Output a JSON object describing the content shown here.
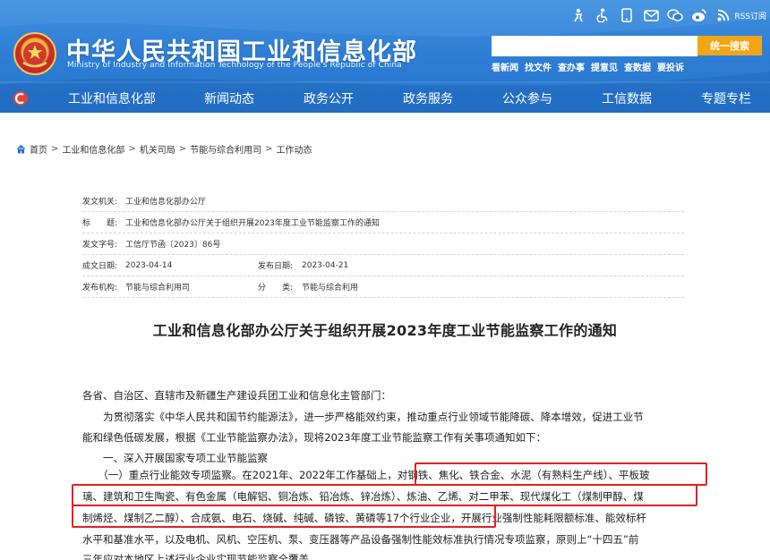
{
  "header": {
    "site_title": "中华人民共和国工业和信息化部",
    "site_subtitle": "Ministry of Industry and Information Technology of the People's Republic of China",
    "search": {
      "placeholder": "",
      "button_label": "统一搜索"
    },
    "quick_links": [
      "看新闻",
      "找文件",
      "查办事",
      "提意见",
      "查数据",
      "要投诉"
    ],
    "rss_label": "RSS订阅",
    "top_icons": [
      "elderly-mode-icon",
      "accessibility-icon",
      "mobile-icon",
      "mail-icon",
      "wechat-icon",
      "weibo-icon",
      "rss-icon"
    ]
  },
  "nav": {
    "items": [
      "工业和信息化部",
      "新闻动态",
      "政务公开",
      "政务服务",
      "公众参与",
      "工信数据",
      "专题专栏"
    ]
  },
  "breadcrumb": [
    "首页",
    "工业和信息化部",
    "机关司局",
    "节能与综合利用司",
    "工作动态"
  ],
  "meta": {
    "issuer_label": "发文机关:",
    "issuer": "工业和信息化部办公厅",
    "title_label": "标　　题:",
    "title": "工业和信息化部办公厅关于组织开展2023年度工业节能监察工作的通知",
    "doc_no_label": "发文字号:",
    "doc_no": "工信厅节函〔2023〕86号",
    "written_label": "成文日期:",
    "written": "2023-04-14",
    "published_label": "发布日期:",
    "published": "2023-04-21",
    "publisher_label": "发布机构:",
    "publisher": "节能与综合利用司",
    "category_label": "分　　类:",
    "category": "节能与综合利用"
  },
  "article": {
    "title": "工业和信息化部办公厅关于组织开展2023年度工业节能监察工作的通知",
    "lines": [
      "各省、自治区、直辖市及新疆生产建设兵团工业和信息化主管部门：",
      "　　为贯彻落实《中华人民共和国节约能源法》，进一步严格能效约束，推动重点行业领域节能降碳、降本增效，促进工业节",
      "能和绿色低碳发展，根据《工业节能监察办法》，现将2023年度工业节能监察工作有关事项通知如下：",
      "　　一、深入开展国家专项工业节能监察",
      "　　（一）重点行业能效专项监察。在2021年、2022年工作基础上，对钢铁、焦化、铁合金、水泥（有熟料生产线）、平板玻",
      "璃、建筑和卫生陶瓷、有色金属（电解铝、铜冶炼、铅冶炼、锌冶炼）、炼油、乙烯、对二甲苯、现代煤化工（煤制甲醇、煤",
      "制烯烃、煤制乙二醇）、合成氨、电石、烧碱、纯碱、磷铵、黄磷等17个行业企业，开展行业强制性能耗限额标准、能效标杆",
      "水平和基准水平，以及电机、风机、空压机、泵、变压器等产品设备强制性能效标准执行情况专项监察，原则上“十四五”前",
      "三年应对本地区上述行业企业实现节能监察全覆盖。"
    ]
  },
  "colors": {
    "header_blue": "#2f7fd6",
    "search_button": "#f2a516",
    "highlight_red": "#e52020"
  }
}
